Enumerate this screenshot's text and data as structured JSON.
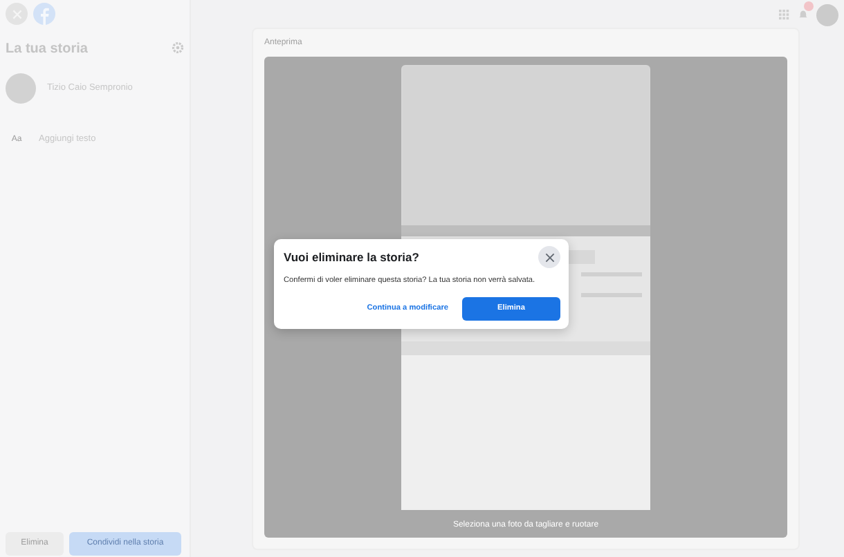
{
  "top_bar": {
    "has_notification": true
  },
  "sidebar": {
    "title": "La tua storia",
    "user_name": "Tizio Caio Sempronio",
    "add_text_icon": "Aa",
    "add_text_label": "Aggiungi testo",
    "buttons": [
      {
        "label": "Elimina",
        "kind": "secondary"
      },
      {
        "label": "Condividi nella storia",
        "kind": "primary"
      }
    ]
  },
  "preview": {
    "label": "Anteprima",
    "caption": "Seleziona una foto da tagliare e ruotare"
  },
  "dialog": {
    "title": "Vuoi eliminare la storia?",
    "message": "Confermi di voler eliminare questa storia? La tua storia non verrà salvata.",
    "buttons": [
      {
        "label": "Continua a modificare",
        "kind": "link"
      },
      {
        "label": "Elimina",
        "kind": "primary"
      }
    ]
  }
}
